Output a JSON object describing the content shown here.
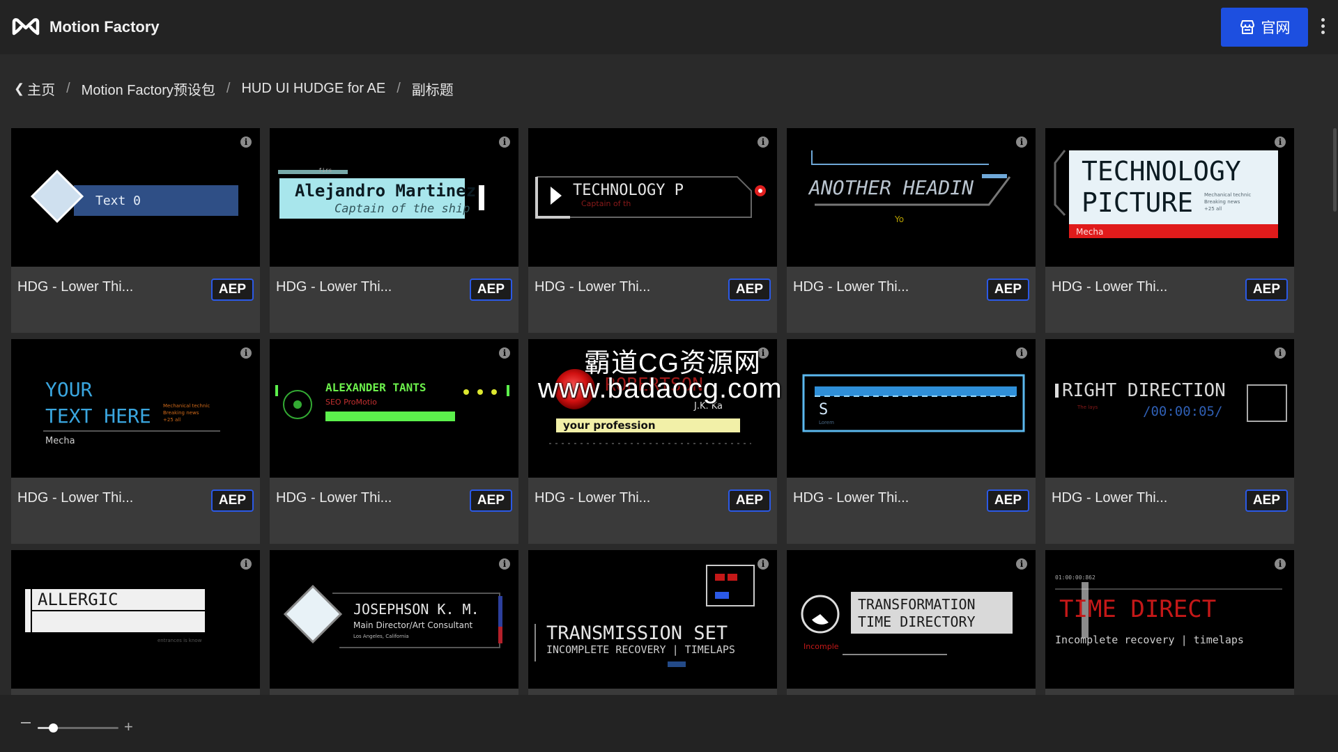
{
  "header": {
    "app_title": "Motion Factory",
    "site_button_label": "官网",
    "logo_icon": "mf-logo-icon",
    "store_icon": "store-icon",
    "menu_icon": "kebab-menu-icon"
  },
  "breadcrumb": {
    "back_icon": "chevron-left-icon",
    "items": [
      "主页",
      "Motion Factory预设包",
      "HUD UI HUDGE for AE",
      "副标题"
    ],
    "separator": "/"
  },
  "grid": {
    "items": [
      {
        "title": "HDG - Lower Thi...",
        "badge": "AEP",
        "preview": [
          "Text 0"
        ]
      },
      {
        "title": "HDG - Lower Thi...",
        "badge": "AEP",
        "preview": [
          "Alejandro Martinez",
          "Captain of the ship",
          "firs"
        ]
      },
      {
        "title": "HDG - Lower Thi...",
        "badge": "AEP",
        "preview": [
          "TECHNOLOGY P",
          "Captain of th"
        ]
      },
      {
        "title": "HDG - Lower Thi...",
        "badge": "AEP",
        "preview": [
          "ANOTHER HEADIN",
          "Yo"
        ]
      },
      {
        "title": "HDG - Lower Thi...",
        "badge": "AEP",
        "preview": [
          "TECHNOLOGY",
          "PICTURE",
          "Mechanical technic",
          "Breaking news",
          "+25 all",
          "Mecha"
        ]
      },
      {
        "title": "HDG - Lower Thi...",
        "badge": "AEP",
        "preview": [
          "YOUR",
          "TEXT HERE",
          "Mechanical technic",
          "Breaking news",
          "+25 all",
          "Mecha"
        ]
      },
      {
        "title": "HDG - Lower Thi...",
        "badge": "AEP",
        "preview": [
          "ALEXANDER TANTS",
          "SEO ProMotio"
        ]
      },
      {
        "title": "HDG - Lower Thi...",
        "badge": "AEP",
        "preview": [
          "ROBERTSON",
          "J.K. Ka",
          "your profession"
        ]
      },
      {
        "title": "HDG - Lower Thi...",
        "badge": "AEP",
        "preview": [
          "S",
          "Lorem"
        ]
      },
      {
        "title": "HDG - Lower Thi...",
        "badge": "AEP",
        "preview": [
          "RIGHT DIRECTION",
          "/00:00:05/",
          "The lays"
        ]
      },
      {
        "title": "",
        "badge": "",
        "preview": [
          "ALLERGIC",
          "entrances is know"
        ]
      },
      {
        "title": "",
        "badge": "",
        "preview": [
          "JOSEPHSON K. M.",
          "Main Director/Art Consultant",
          "Los Angeles, California"
        ]
      },
      {
        "title": "",
        "badge": "",
        "preview": [
          "TRANSMISSION SET",
          "INCOMPLETE RECOVERY | TIMELAPS"
        ]
      },
      {
        "title": "",
        "badge": "",
        "preview": [
          "TRANSFORMATION",
          "TIME DIRECTORY",
          "Incomple"
        ]
      },
      {
        "title": "",
        "badge": "",
        "preview": [
          "TIME DIRECT",
          "Incomplete recovery | timelaps",
          "01:00:00:862"
        ]
      }
    ]
  },
  "watermark": {
    "line1": "霸道CG资源网",
    "line2": "www.badaocg.com"
  },
  "zoom": {
    "value_fraction": 0.19,
    "minus_icon": "minus-icon",
    "plus_icon": "plus-icon"
  },
  "colors": {
    "accent": "#1d4fe0",
    "badge_border": "#2b59e6",
    "background": "#2a2a2a",
    "card": "#3a3a3a"
  }
}
